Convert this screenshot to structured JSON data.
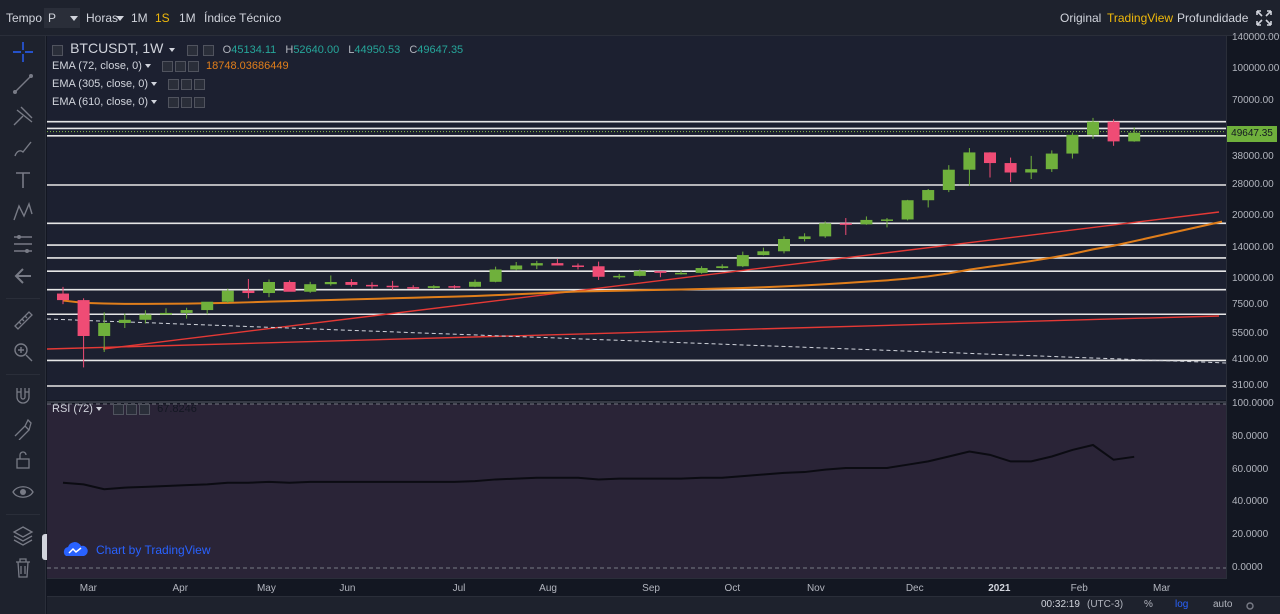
{
  "toolbar": {
    "time_label": "Tempo",
    "interval_selected": "P",
    "hours_label": "Horas",
    "btn_1m": "1M",
    "btn_1s": "1S",
    "btn_1mo": "1M",
    "indicators_label": "Índice Técnico",
    "view_original": "Original",
    "view_tradingview": "TradingView",
    "view_depth": "Profundidade",
    "accent_color": "#f0b90b"
  },
  "legend": {
    "symbol": "BTCUSDT, 1W",
    "open_label": "O",
    "open": "45134.11",
    "high_label": "H",
    "high": "52640.00",
    "low_label": "L",
    "low": "44950.53",
    "close_label": "C",
    "close": "49647.35",
    "ema72_label": "EMA (72, close, 0)",
    "ema72_value": "18748.03686449",
    "ema305_label": "EMA (305, close, 0)",
    "ema610_label": "EMA (610, close, 0)",
    "rsi_label": "RSI (72)",
    "rsi_value": "67.8246"
  },
  "price_axis": [
    "140000.00",
    "100000.00",
    "70000.00",
    "49647.35",
    "38000.00",
    "28000.00",
    "20000.00",
    "14000.00",
    "10000.00",
    "7500.00",
    "5500.00",
    "4100.00",
    "3100.00"
  ],
  "rsi_axis": [
    "100.0000",
    "80.0000",
    "60.0000",
    "40.0000",
    "20.0000",
    "0.0000"
  ],
  "time_axis": [
    "Mar",
    "Apr",
    "May",
    "Jun",
    "Jul",
    "Aug",
    "Sep",
    "Oct",
    "Nov",
    "Dec",
    "2021",
    "Feb",
    "Mar"
  ],
  "bottom": {
    "clock": "00:32:19",
    "timezone": "(UTC-3)",
    "percent": "%",
    "log": "log",
    "auto": "auto"
  },
  "watermark": "Chart by TradingView",
  "colors": {
    "up": "#6fb03c",
    "down": "#ef4c75",
    "ema72": "#e07e1b",
    "ema_red": "#e53935",
    "rsi_line": "#0b0b12"
  },
  "chart_data": {
    "type": "candlestick",
    "log_scale": true,
    "ylim": [
      3100,
      140000
    ],
    "x": [
      "2020-03-02",
      "2020-03-09",
      "2020-03-16",
      "2020-03-23",
      "2020-03-30",
      "2020-04-06",
      "2020-04-13",
      "2020-04-20",
      "2020-04-27",
      "2020-05-04",
      "2020-05-11",
      "2020-05-18",
      "2020-05-25",
      "2020-06-01",
      "2020-06-08",
      "2020-06-15",
      "2020-06-22",
      "2020-06-29",
      "2020-07-06",
      "2020-07-13",
      "2020-07-20",
      "2020-07-27",
      "2020-08-03",
      "2020-08-10",
      "2020-08-17",
      "2020-08-24",
      "2020-08-31",
      "2020-09-07",
      "2020-09-14",
      "2020-09-21",
      "2020-09-28",
      "2020-10-05",
      "2020-10-12",
      "2020-10-19",
      "2020-10-26",
      "2020-11-02",
      "2020-11-09",
      "2020-11-16",
      "2020-11-23",
      "2020-11-30",
      "2020-12-07",
      "2020-12-14",
      "2020-12-21",
      "2020-12-28",
      "2021-01-04",
      "2021-01-11",
      "2021-01-18",
      "2021-01-25",
      "2021-02-01",
      "2021-02-08",
      "2021-02-15",
      "2021-02-22",
      "2021-03-01"
    ],
    "open": [
      8530,
      7940,
      5360,
      6180,
      6400,
      6780,
      6900,
      7120,
      7800,
      8800,
      8580,
      9680,
      8700,
      9450,
      9680,
      9380,
      9290,
      9150,
      9070,
      9250,
      9190,
      9700,
      11100,
      11600,
      11900,
      11600,
      11500,
      10250,
      10350,
      10900,
      10700,
      10700,
      11280,
      11500,
      13000,
      13550,
      15500,
      15950,
      18400,
      18200,
      19100,
      19200,
      23700,
      26500,
      33100,
      40000,
      35600,
      32100,
      33300,
      39500,
      48500,
      56000,
      45134
    ],
    "high": [
      9180,
      8100,
      6950,
      6850,
      7100,
      7260,
      7300,
      7700,
      9000,
      10000,
      9950,
      9850,
      9700,
      10400,
      10000,
      9660,
      9800,
      9340,
      9350,
      9350,
      9950,
      11450,
      12050,
      12200,
      12470,
      11850,
      12100,
      10580,
      11100,
      10900,
      10960,
      11500,
      11750,
      13500,
      14100,
      15950,
      16500,
      18800,
      19500,
      19850,
      19500,
      23800,
      26800,
      34800,
      41950,
      40100,
      37800,
      38500,
      40900,
      49700,
      58350,
      57500,
      52640
    ],
    "low": [
      7600,
      3800,
      4500,
      5850,
      6150,
      6780,
      6480,
      6800,
      7700,
      8100,
      8200,
      8800,
      8600,
      9300,
      9200,
      9000,
      8900,
      8950,
      9000,
      9000,
      9150,
      9650,
      11000,
      11150,
      11600,
      11100,
      9900,
      10000,
      10300,
      10200,
      10500,
      10600,
      11200,
      11400,
      12950,
      13250,
      15100,
      15700,
      16200,
      18100,
      17600,
      19000,
      21900,
      25900,
      27700,
      30400,
      28900,
      29900,
      32300,
      37400,
      46400,
      43000,
      44950
    ],
    "close": [
      7940,
      5360,
      6180,
      6400,
      6780,
      6900,
      7120,
      7800,
      8800,
      8580,
      9680,
      8700,
      9450,
      9680,
      9380,
      9290,
      9150,
      9070,
      9250,
      9190,
      9700,
      11100,
      11600,
      11900,
      11600,
      11500,
      10250,
      10350,
      10900,
      10700,
      10700,
      11280,
      11500,
      13000,
      13550,
      15500,
      15950,
      18400,
      18200,
      19100,
      19200,
      23700,
      26500,
      33100,
      40000,
      35600,
      32100,
      33300,
      39500,
      48500,
      56000,
      45134,
      49647
    ],
    "ema72": [
      7900,
      7700,
      7650,
      7620,
      7620,
      7630,
      7640,
      7670,
      7700,
      7750,
      7810,
      7850,
      7900,
      7950,
      8000,
      8050,
      8100,
      8150,
      8200,
      8250,
      8300,
      8380,
      8460,
      8550,
      8640,
      8720,
      8760,
      8800,
      8840,
      8880,
      8920,
      8960,
      9010,
      9070,
      9140,
      9230,
      9330,
      9450,
      9580,
      9720,
      9860,
      10050,
      10300,
      10640,
      11080,
      11450,
      11800,
      12180,
      12640,
      13170,
      13840,
      14400,
      18748
    ],
    "hlines": [
      3100,
      4100,
      6800,
      8900,
      10900,
      12600,
      14500,
      18400,
      28000,
      48000,
      52000,
      56000
    ],
    "rsi": [
      52,
      51,
      48,
      49,
      49.5,
      50,
      50.5,
      51,
      52,
      52,
      52.5,
      52,
      52.5,
      52.5,
      52.5,
      52.5,
      52.5,
      52.5,
      52.5,
      52.5,
      53,
      54,
      54.5,
      55,
      55,
      55,
      54,
      54.5,
      54.5,
      54.5,
      54.5,
      55,
      55,
      56,
      57,
      58,
      58.5,
      60,
      61,
      61,
      61,
      63,
      65,
      68,
      71,
      69,
      65,
      65,
      68,
      72,
      75,
      66,
      67.8
    ]
  }
}
